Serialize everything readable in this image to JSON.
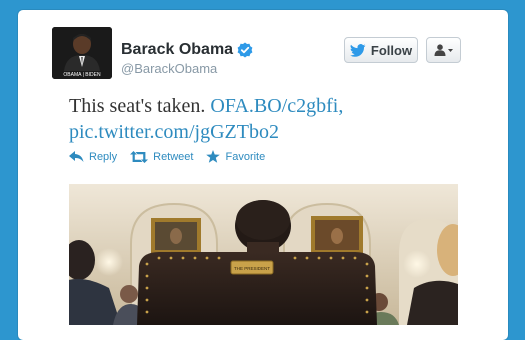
{
  "tweet": {
    "author_name": "Barack Obama",
    "handle": "@BarackObama",
    "text": "This seat's taken.",
    "link1": "OFA.BO/c2gbfi,",
    "link2": "pic.twitter.com/jgGZTbo2",
    "avatar_caption": "OBAMA | BIDEN"
  },
  "buttons": {
    "follow_label": "Follow"
  },
  "actions": {
    "reply": "Reply",
    "retweet": "Retweet",
    "favorite": "Favorite"
  },
  "photo": {
    "plaque_text": "THE PRESIDENT"
  },
  "colors": {
    "background": "#2d96cf",
    "link": "#2e8bbf",
    "verified": "#2e9ae8"
  }
}
